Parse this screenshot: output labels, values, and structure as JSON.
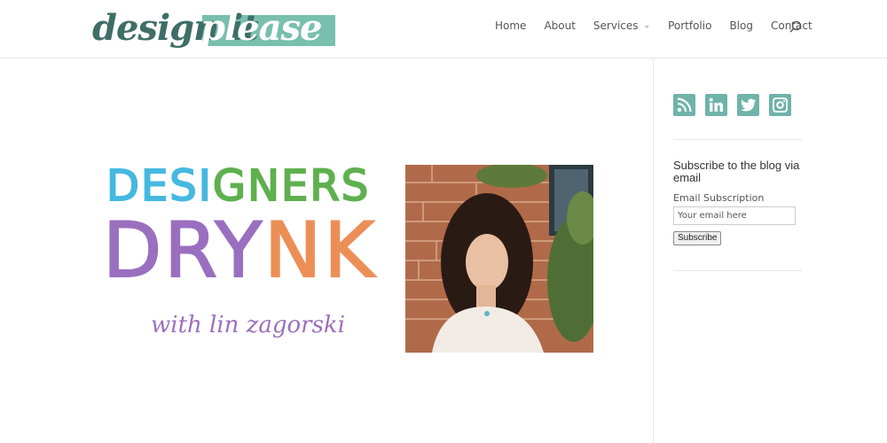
{
  "header": {
    "logo_text_1": "design it",
    "logo_text_2": "please",
    "nav": [
      {
        "label": "Home"
      },
      {
        "label": "About"
      },
      {
        "label": "Services",
        "has_dropdown": true
      },
      {
        "label": "Portfolio"
      },
      {
        "label": "Blog"
      },
      {
        "label": "Contact"
      }
    ]
  },
  "feature": {
    "line1": [
      "DESI",
      "GN",
      "ERS"
    ],
    "line2": [
      "DR",
      "Y",
      "NK"
    ],
    "subtitle": "with lin zagorski",
    "colors": {
      "blue": "#45b8e0",
      "green": "#5fb04f",
      "purple": "#9b6fc0",
      "orange": "#ec8f57"
    }
  },
  "sidebar": {
    "social": [
      {
        "icon": "rss-icon"
      },
      {
        "icon": "linkedin-icon"
      },
      {
        "icon": "twitter-icon"
      },
      {
        "icon": "instagram-icon"
      }
    ],
    "subscribe_title": "Subscribe to the blog via email",
    "email_label": "Email Subscription",
    "email_placeholder": "Your email here",
    "subscribe_button": "Subscribe"
  },
  "colors": {
    "accent": "#6fb3a9",
    "logo_dark": "#3f6e67"
  }
}
